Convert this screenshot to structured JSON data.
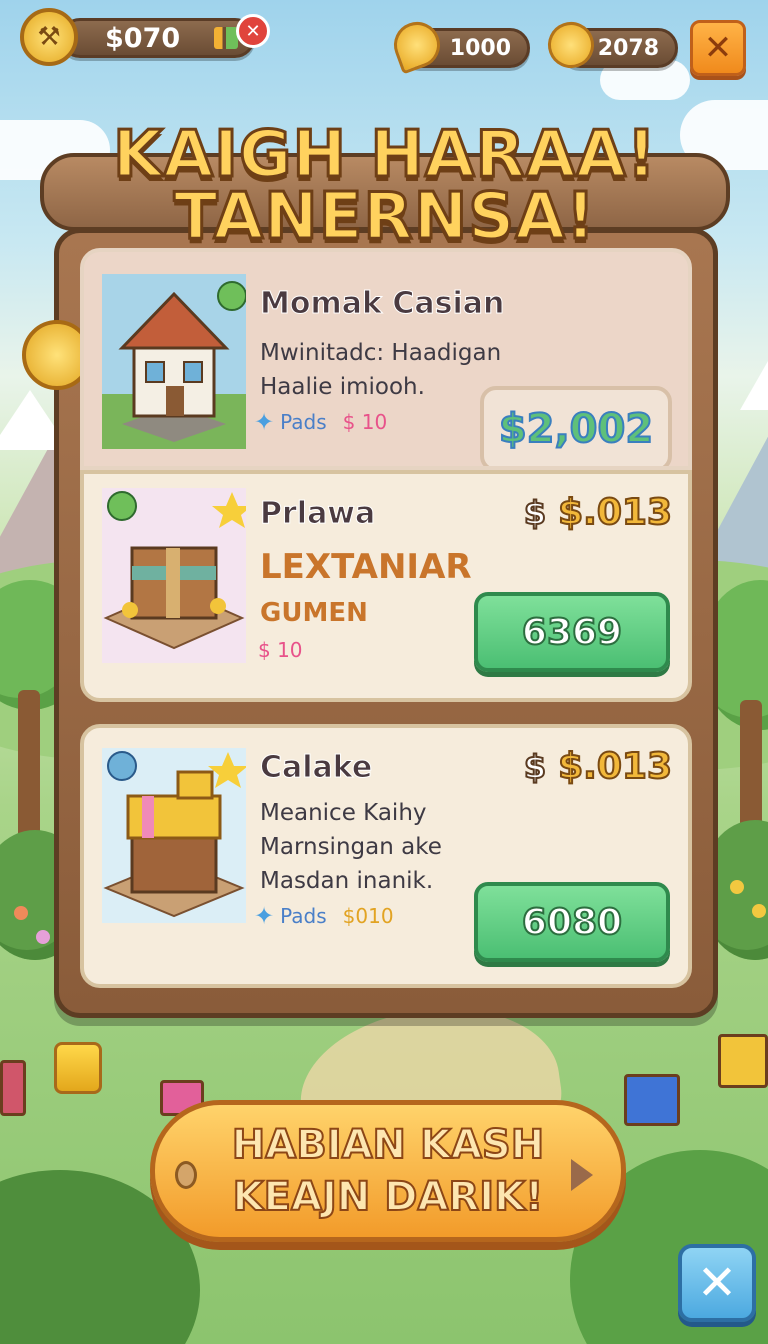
{
  "hud": {
    "money": "$070",
    "resource_1": "1000",
    "resource_2": "2078",
    "close_label": "✕",
    "dismiss_label": "✕"
  },
  "title": {
    "line1": "KAIGH HARAA!",
    "line2": "TANERNSA!"
  },
  "offers": [
    {
      "name": "Momak Casian",
      "description_line1": "Mwinitadc: Haadigan",
      "description_line2": "Haalie imiooh.",
      "tag_label": "Pads",
      "tag_cost": "$ 10",
      "button_label": "$2,002"
    },
    {
      "name": "Prlawa",
      "price": "$.013",
      "price_symbol": "$",
      "highlight_line1": "LEXTANIAR",
      "highlight_line2": "GUMEN",
      "tag_cost": "$ 10",
      "button_label": "6369"
    },
    {
      "name": "Calake",
      "price": "$.013",
      "price_symbol": "$",
      "description_line1": "Meanice Kaihy",
      "description_line2": "Marnsingan ake",
      "description_line3": "Masdan inanik.",
      "tag_label": "Pads",
      "tag_cost": "$010",
      "button_label": "6080"
    }
  ],
  "cta": {
    "line1": "HABIAN KASH",
    "line2": "KEAJN DARIK!"
  },
  "bottom_close_label": "✕",
  "colors": {
    "board": "#8a5c3a",
    "button_green": "#4bbf73",
    "cta_orange": "#f29b2a",
    "gold_text": "#f2b83a"
  }
}
